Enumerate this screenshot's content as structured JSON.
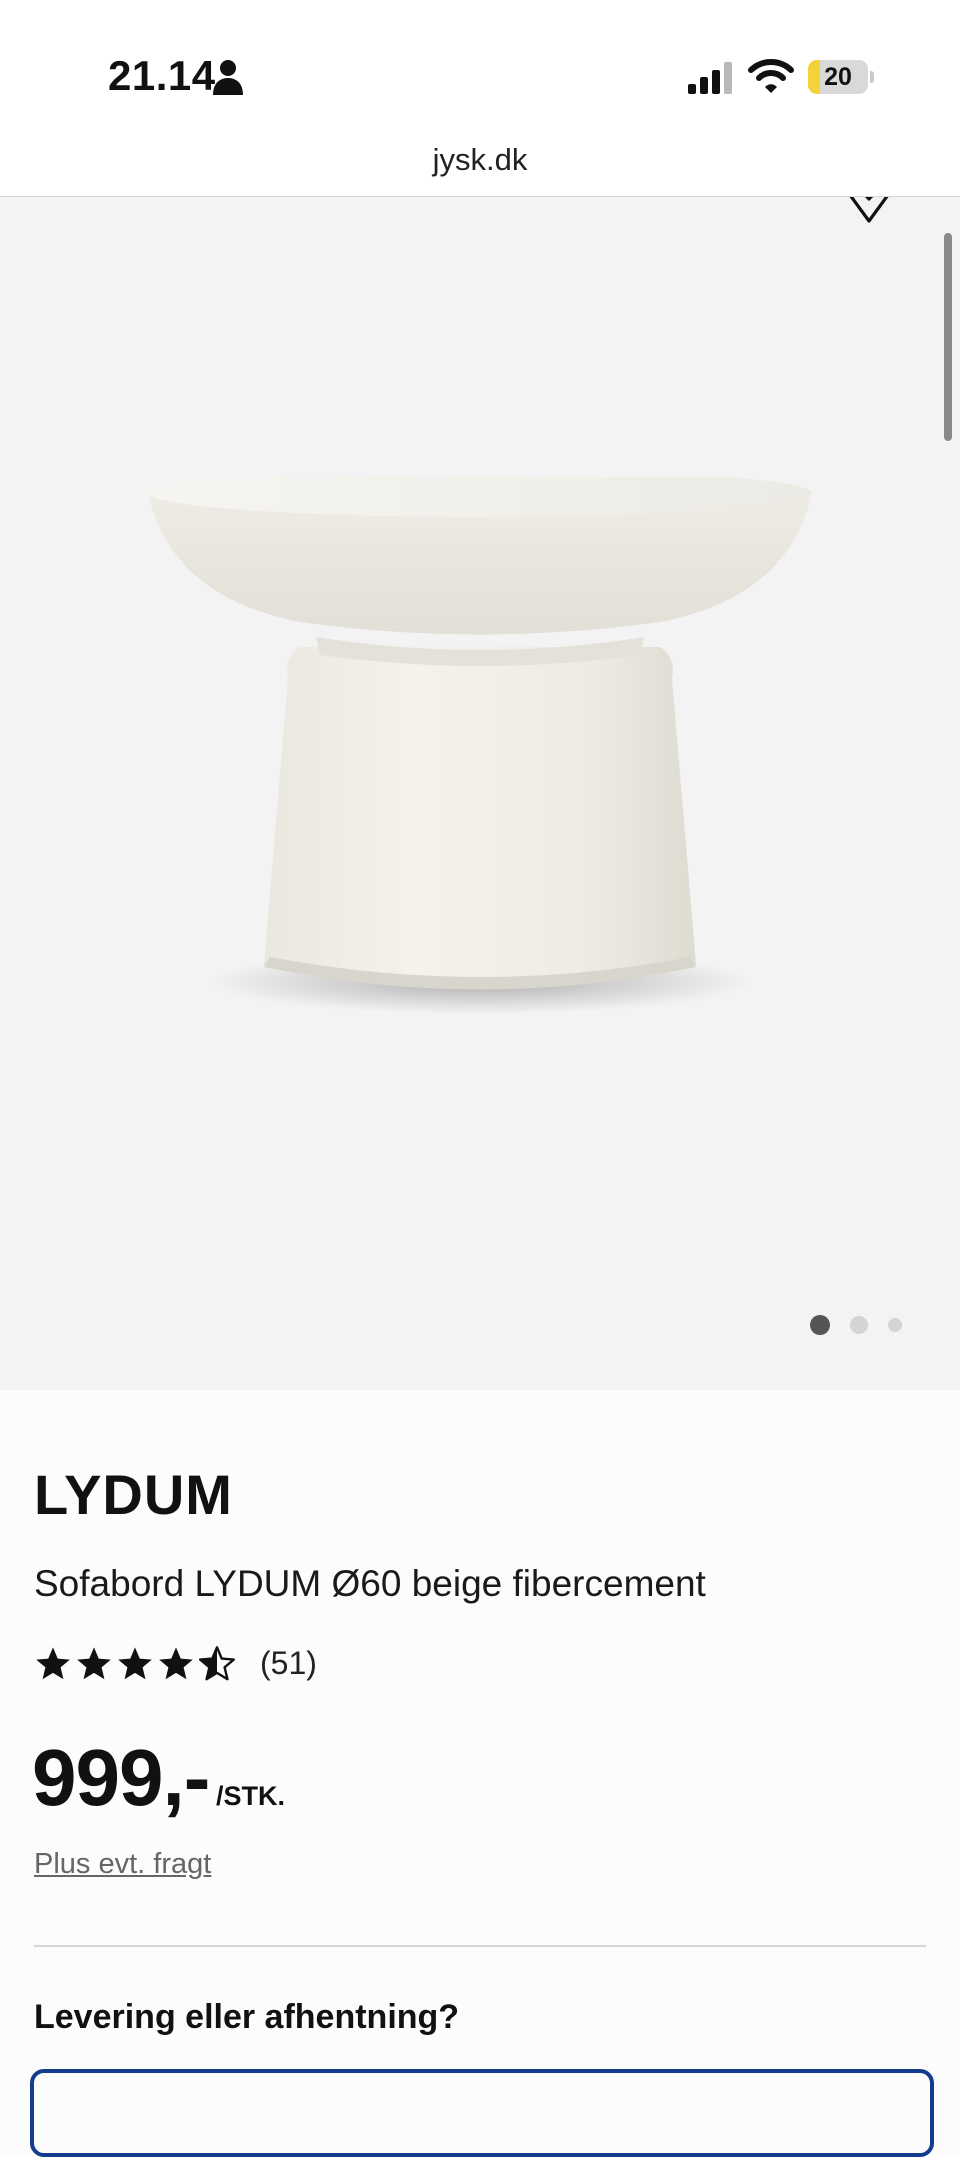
{
  "status_bar": {
    "time": "21.14",
    "battery": "20",
    "battery_level": 0.2,
    "icons": [
      "person-icon",
      "signal-icon",
      "wifi-icon",
      "battery-icon"
    ]
  },
  "browser": {
    "url": "jysk.dk"
  },
  "gallery": {
    "image": "white round coffee table on pedestal base",
    "favorite_icon": "heart-icon",
    "active_index": 0,
    "total": 3
  },
  "product": {
    "brand": "LYDUM",
    "name": "Sofabord LYDUM Ø60 beige fibercement",
    "rating_value": 4.5,
    "rating_max": 5,
    "review_count": "(51)",
    "price": "999,-",
    "unit": "/STK.",
    "freight_link": "Plus evt. fragt"
  },
  "delivery": {
    "heading": "Levering eller afhentning?"
  },
  "colors": {
    "accent": "#143c8c",
    "battery": "#f4d33a",
    "gallery_bg": "#f3f3f3"
  }
}
